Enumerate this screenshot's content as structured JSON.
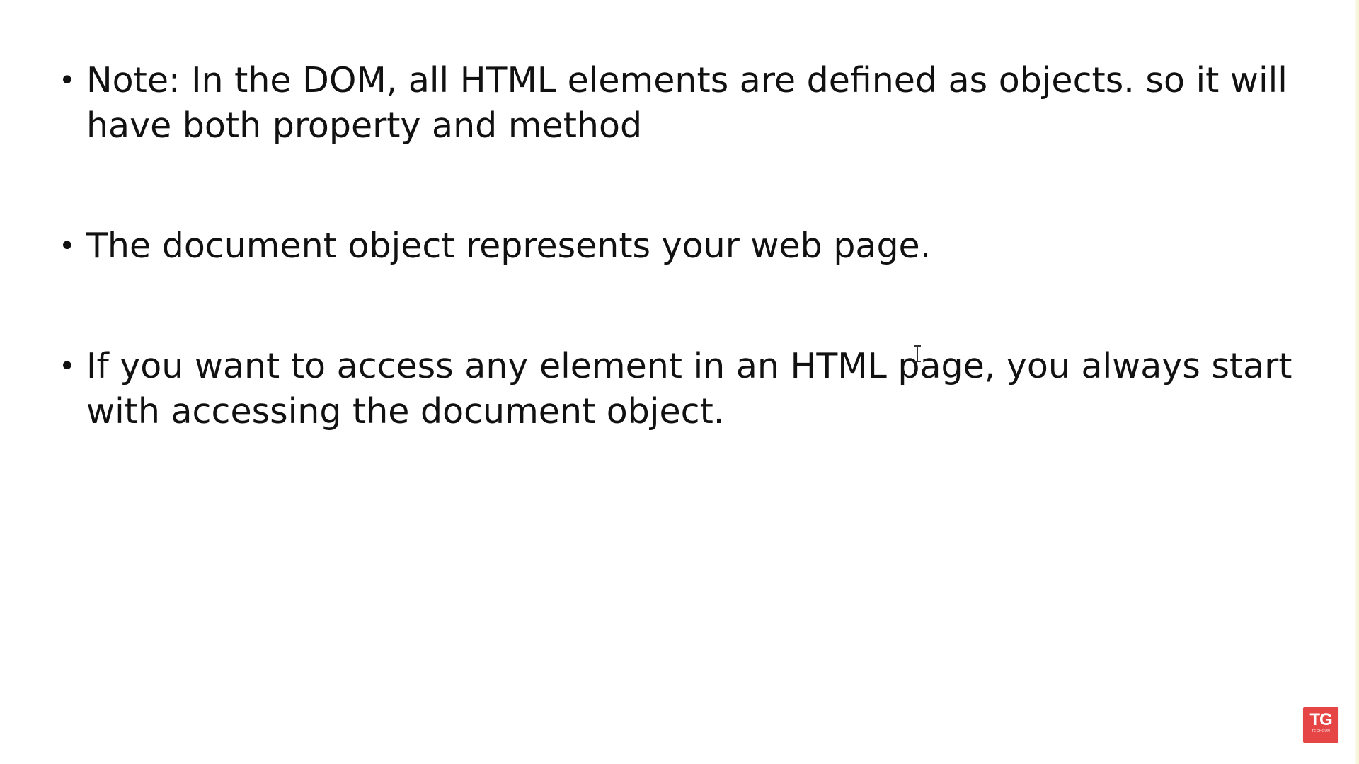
{
  "slide": {
    "bullets": [
      {
        "text": "Note: In the DOM, all HTML elements are defined as objects. so it will have both property and method"
      },
      {
        "text": "The document object represents your web page."
      },
      {
        "text": "If you want to access any element in an HTML page, you always start with accessing the document object."
      }
    ],
    "bullet_symbol": "•"
  },
  "logo": {
    "mark": "TG",
    "subtext": "TECHGUN",
    "color": "#e64545"
  },
  "cursor": {
    "type": "i-beam-cursor-icon"
  }
}
